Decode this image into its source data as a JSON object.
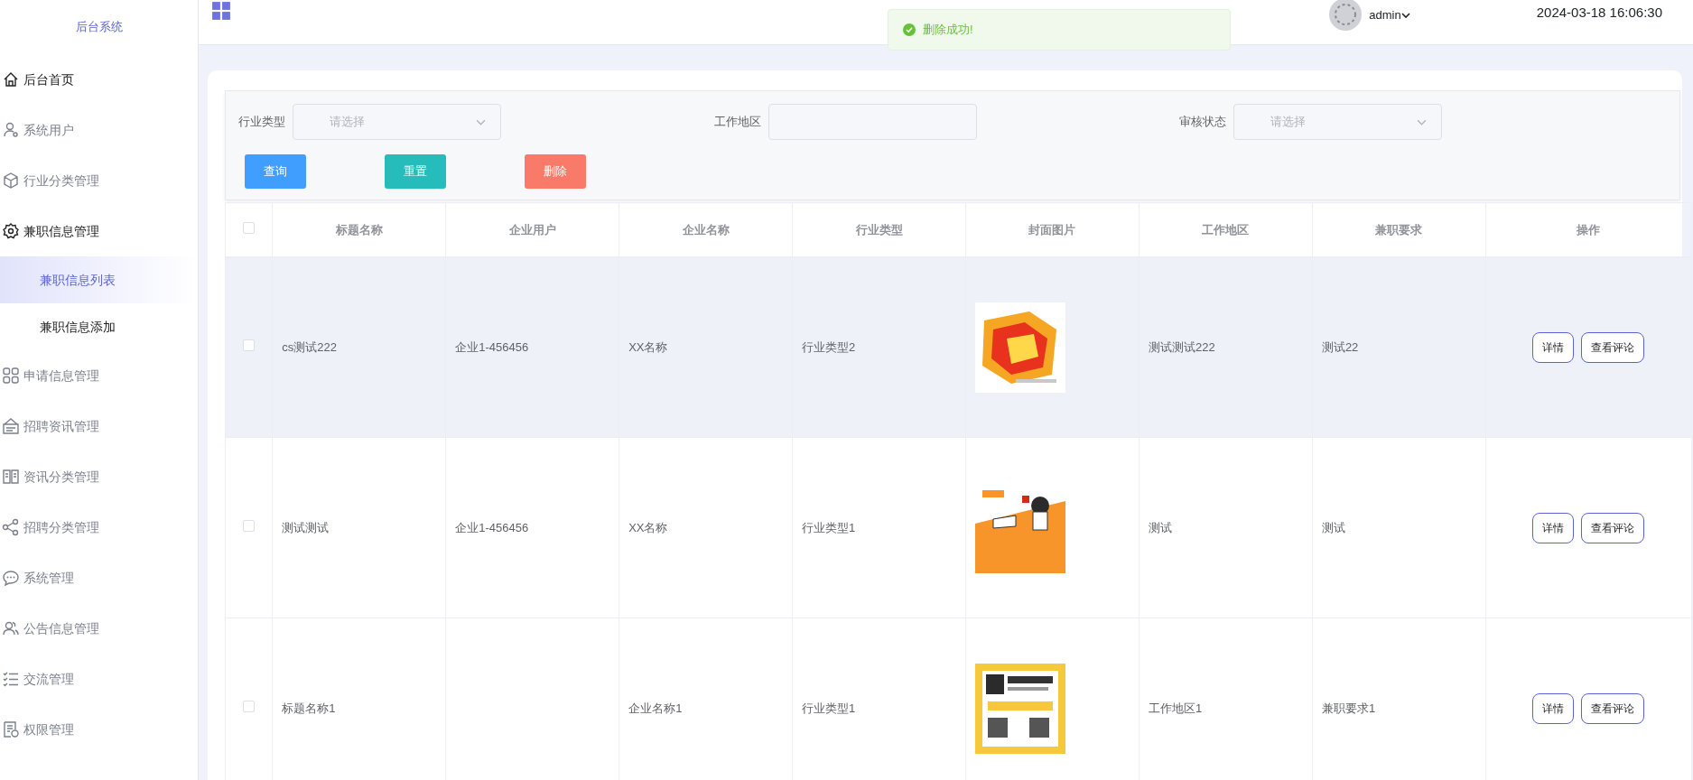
{
  "sidebar": {
    "title": "后台系统",
    "items": [
      {
        "label": "后台首页",
        "active": true
      },
      {
        "label": "系统用户",
        "active": false
      },
      {
        "label": "行业分类管理",
        "active": false
      },
      {
        "label": "兼职信息管理",
        "active": true,
        "children": [
          {
            "label": "兼职信息列表",
            "selected": true
          },
          {
            "label": "兼职信息添加",
            "selected": false
          }
        ]
      },
      {
        "label": "申请信息管理",
        "active": false
      },
      {
        "label": "招聘资讯管理",
        "active": false
      },
      {
        "label": "资讯分类管理",
        "active": false
      },
      {
        "label": "招聘分类管理",
        "active": false
      },
      {
        "label": "系统管理",
        "active": false
      },
      {
        "label": "公告信息管理",
        "active": false
      },
      {
        "label": "交流管理",
        "active": false
      },
      {
        "label": "权限管理",
        "active": false
      }
    ]
  },
  "header": {
    "user": "admin",
    "datetime": "2024-03-18 16:06:30"
  },
  "toast": {
    "message": "删除成功!",
    "kind": "success"
  },
  "filters": [
    {
      "label": "行业类型",
      "kind": "select",
      "placeholder": "请选择"
    },
    {
      "label": "工作地区",
      "kind": "input"
    },
    {
      "label": "审核状态",
      "kind": "select",
      "placeholder": "请选择"
    }
  ],
  "actions": [
    {
      "label": "查询",
      "kind": "primary"
    },
    {
      "label": "重置",
      "kind": "reset"
    },
    {
      "label": "删除",
      "kind": "danger"
    }
  ],
  "table": {
    "all_checked": false,
    "columns": [
      "标题名称",
      "企业用户",
      "企业名称",
      "行业类型",
      "封面图片",
      "工作地区",
      "兼职要求",
      "操作"
    ],
    "rows": [
      {
        "checked": false,
        "highlighted": true,
        "cells": [
          "cs测试222",
          "企业1-456456",
          "XX名称",
          "行业类型2",
          "",
          "测试测试222",
          "测试22"
        ],
        "buttons": [
          "详情",
          "查看评论"
        ]
      },
      {
        "checked": false,
        "highlighted": false,
        "cells": [
          "测试测试",
          "企业1-456456",
          "XX名称",
          "行业类型1",
          "",
          "测试",
          "测试"
        ],
        "buttons": [
          "详情",
          "查看评论"
        ]
      },
      {
        "checked": false,
        "highlighted": false,
        "cells": [
          "标题名称1",
          "",
          "企业名称1",
          "行业类型1",
          "",
          "工作地区1",
          "兼职要求1"
        ],
        "buttons": [
          "详情",
          "查看评论"
        ]
      }
    ]
  }
}
